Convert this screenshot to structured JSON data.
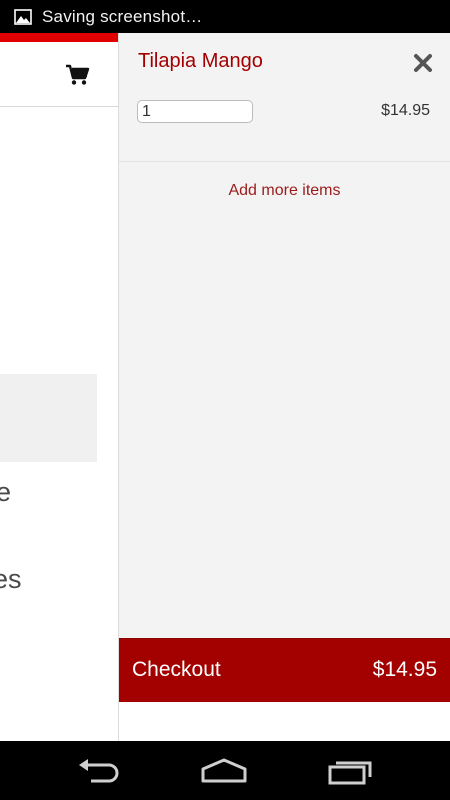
{
  "status_bar": {
    "notification_icon": "image-icon",
    "text": "Saving screenshot…"
  },
  "background_app": {
    "cart_icon": "shopping-cart-icon",
    "text_fragment_1": "e",
    "text_fragment_2": "nes",
    "accent_color": "#e00000"
  },
  "cart": {
    "item": {
      "name": "Tilapia Mango",
      "quantity": "1",
      "price": "$14.95",
      "remove_icon": "close-icon"
    },
    "add_more_label": "Add more items",
    "checkout": {
      "label": "Checkout",
      "total": "$14.95",
      "color": "#a30000"
    }
  },
  "nav_bar": {
    "back_icon": "back-icon",
    "home_icon": "home-icon",
    "recents_icon": "recents-icon"
  }
}
